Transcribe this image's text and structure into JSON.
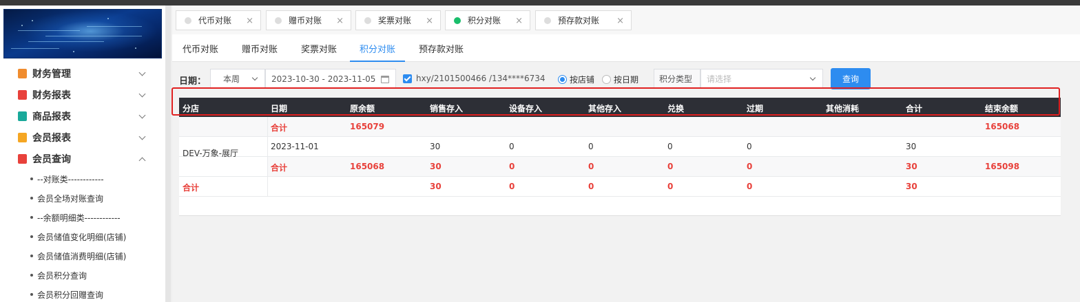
{
  "tab_strip": [
    {
      "label": "代币对账",
      "active": false
    },
    {
      "label": "赠币对账",
      "active": false
    },
    {
      "label": "奖票对账",
      "active": false
    },
    {
      "label": "积分对账",
      "active": true
    },
    {
      "label": "预存款对账",
      "active": false
    }
  ],
  "subtabs": {
    "items": [
      "代币对账",
      "赠币对账",
      "奖票对账",
      "积分对账",
      "预存款对账"
    ],
    "active_index": 3
  },
  "sidebar": {
    "menu": [
      {
        "label": "财务管理",
        "icon": "finance-manage-icon",
        "color": "#f08c2e",
        "expanded": false
      },
      {
        "label": "财务报表",
        "icon": "finance-report-icon",
        "color": "#e8413b",
        "expanded": false
      },
      {
        "label": "商品报表",
        "icon": "goods-report-icon",
        "color": "#19a99a",
        "expanded": false
      },
      {
        "label": "会员报表",
        "icon": "member-report-icon",
        "color": "#f5a623",
        "expanded": false
      },
      {
        "label": "会员查询",
        "icon": "member-query-icon",
        "color": "#e8413b",
        "expanded": true
      }
    ],
    "sub_items": [
      "--对账类------------",
      "会员全场对账查询",
      "--余额明细类------------",
      "会员储值变化明细(店铺)",
      "会员储值消费明细(店铺)",
      "会员积分查询",
      "会员积分回赠查询"
    ]
  },
  "filters": {
    "date_label": "日期：",
    "period_value": "本周",
    "date_range": "2023-10-30 - 2023-11-05",
    "store_checkbox": "hxy/2101500466 /134****6734",
    "store_checked": true,
    "radio_by_store": "按店铺",
    "radio_by_date": "按日期",
    "radio_selected": "按店铺",
    "points_type_label": "积分类型",
    "points_type_placeholder": "请选择",
    "query_button": "查询"
  },
  "table": {
    "headers": [
      "分店",
      "日期",
      "原余额",
      "销售存入",
      "设备存入",
      "其他存入",
      "兑换",
      "过期",
      "其他消耗",
      "合计",
      "结束余额"
    ],
    "rows": [
      {
        "shop": "",
        "date": "合计",
        "original_balance": "165079",
        "sales_in": "",
        "device_in": "",
        "other_in": "",
        "exchange": "",
        "expired": "",
        "other_consume": "",
        "total": "",
        "end_balance": "165068",
        "is_total": true
      },
      {
        "shop": "DEV-万象-展厅",
        "date": "2023-11-01",
        "original_balance": "",
        "sales_in": "30",
        "device_in": "0",
        "other_in": "0",
        "exchange": "0",
        "expired": "0",
        "other_consume": "",
        "total": "30",
        "end_balance": "",
        "is_total": false
      },
      {
        "shop": "",
        "date": "合计",
        "original_balance": "165068",
        "sales_in": "30",
        "device_in": "0",
        "other_in": "0",
        "exchange": "0",
        "expired": "0",
        "other_consume": "",
        "total": "30",
        "end_balance": "165098",
        "is_total": true
      },
      {
        "shop": "合计",
        "date": "",
        "original_balance": "",
        "sales_in": "30",
        "device_in": "0",
        "other_in": "0",
        "exchange": "0",
        "expired": "0",
        "other_consume": "",
        "total": "30",
        "end_balance": "",
        "is_total": true
      }
    ]
  },
  "colors": {
    "accent": "#2d8cf0",
    "table_header_bg": "#2d2f36",
    "total_text": "#e8413b",
    "active_dot": "#19be6b",
    "highlight_border": "#e02020"
  }
}
